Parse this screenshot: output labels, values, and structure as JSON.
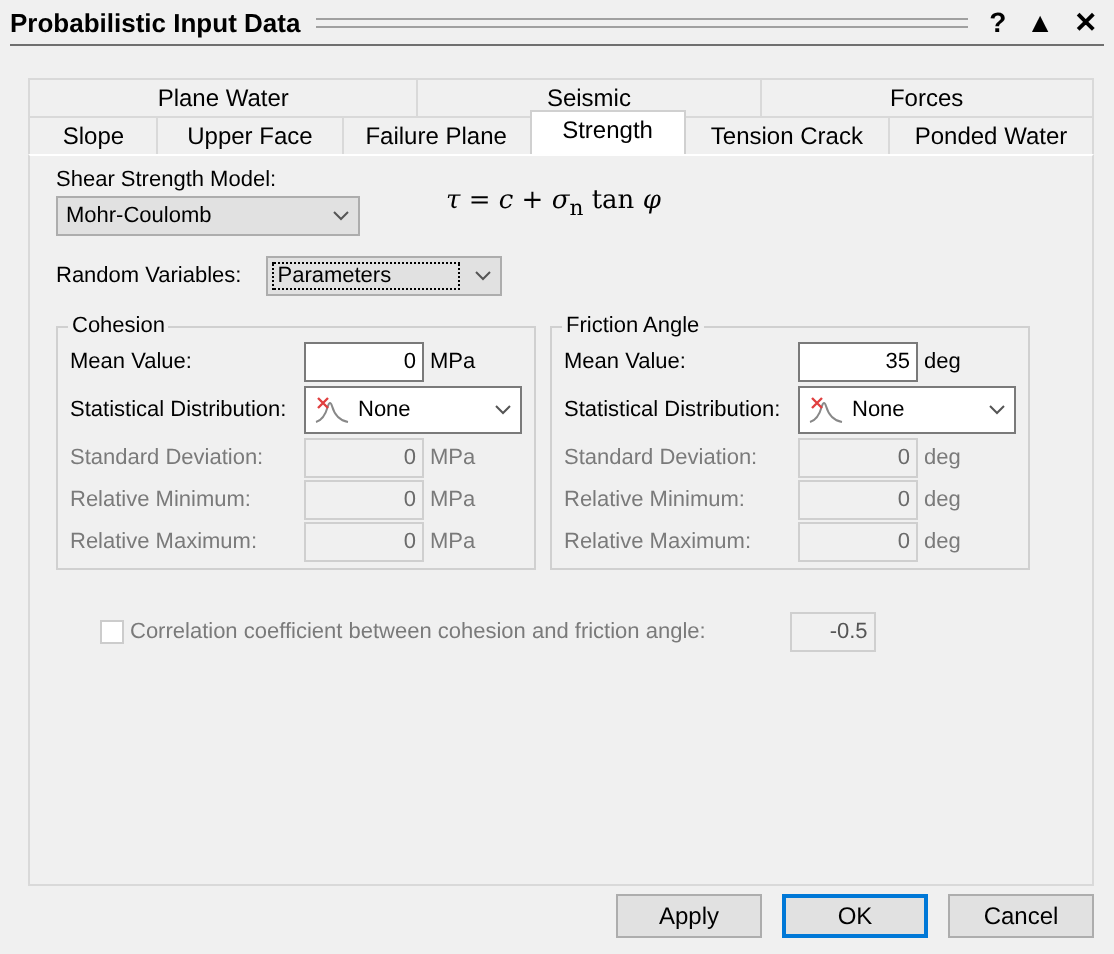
{
  "window": {
    "title": "Probabilistic Input Data",
    "controls": [
      "?",
      "▲",
      "✕"
    ]
  },
  "tab_rows": [
    [
      {
        "label": "Plane Water",
        "selected": false
      },
      {
        "label": "Seismic",
        "selected": false
      },
      {
        "label": "Forces",
        "selected": false
      }
    ],
    [
      {
        "label": "Slope",
        "selected": false
      },
      {
        "label": "Upper Face",
        "selected": false
      },
      {
        "label": "Failure Plane",
        "selected": false
      },
      {
        "label": "Strength",
        "selected": true
      },
      {
        "label": "Tension Crack",
        "selected": false
      },
      {
        "label": "Ponded Water",
        "selected": false
      }
    ]
  ],
  "shear_strength_model": {
    "label": "Shear Strength Model:",
    "value": "Mohr-Coulomb",
    "formula": "*τ* = *c* + *σ*$_{n}$ tan *φ*"
  },
  "random_variables": {
    "label": "Random Variables:",
    "value": "Parameters"
  },
  "groups": [
    {
      "title": "Cohesion",
      "rows": [
        {
          "kind": "input",
          "label": "Mean Value:",
          "value": "0",
          "unit": "MPa",
          "disabled": false
        },
        {
          "kind": "dropdown",
          "label": "Statistical Distribution:",
          "value": "None",
          "disabled": false
        },
        {
          "kind": "input",
          "label": "Standard Deviation:",
          "value": "0",
          "unit": "MPa",
          "disabled": true
        },
        {
          "kind": "input",
          "label": "Relative Minimum:",
          "value": "0",
          "unit": "MPa",
          "disabled": true
        },
        {
          "kind": "input",
          "label": "Relative Maximum:",
          "value": "0",
          "unit": "MPa",
          "disabled": true
        }
      ]
    },
    {
      "title": "Friction Angle",
      "rows": [
        {
          "kind": "input",
          "label": "Mean Value:",
          "value": "35",
          "unit": "deg",
          "disabled": false
        },
        {
          "kind": "dropdown",
          "label": "Statistical Distribution:",
          "value": "None",
          "disabled": false
        },
        {
          "kind": "input",
          "label": "Standard Deviation:",
          "value": "0",
          "unit": "deg",
          "disabled": true
        },
        {
          "kind": "input",
          "label": "Relative Minimum:",
          "value": "0",
          "unit": "deg",
          "disabled": true
        },
        {
          "kind": "input",
          "label": "Relative Maximum:",
          "value": "0",
          "unit": "deg",
          "disabled": true
        }
      ]
    }
  ],
  "correlation": {
    "label": "Correlation coefficient between cohesion and friction angle:",
    "checked": false,
    "disabled": true,
    "value": "-0.5"
  },
  "buttons": [
    {
      "label": "Apply",
      "default": false
    },
    {
      "label": "OK",
      "default": true
    },
    {
      "label": "Cancel",
      "default": false
    }
  ]
}
